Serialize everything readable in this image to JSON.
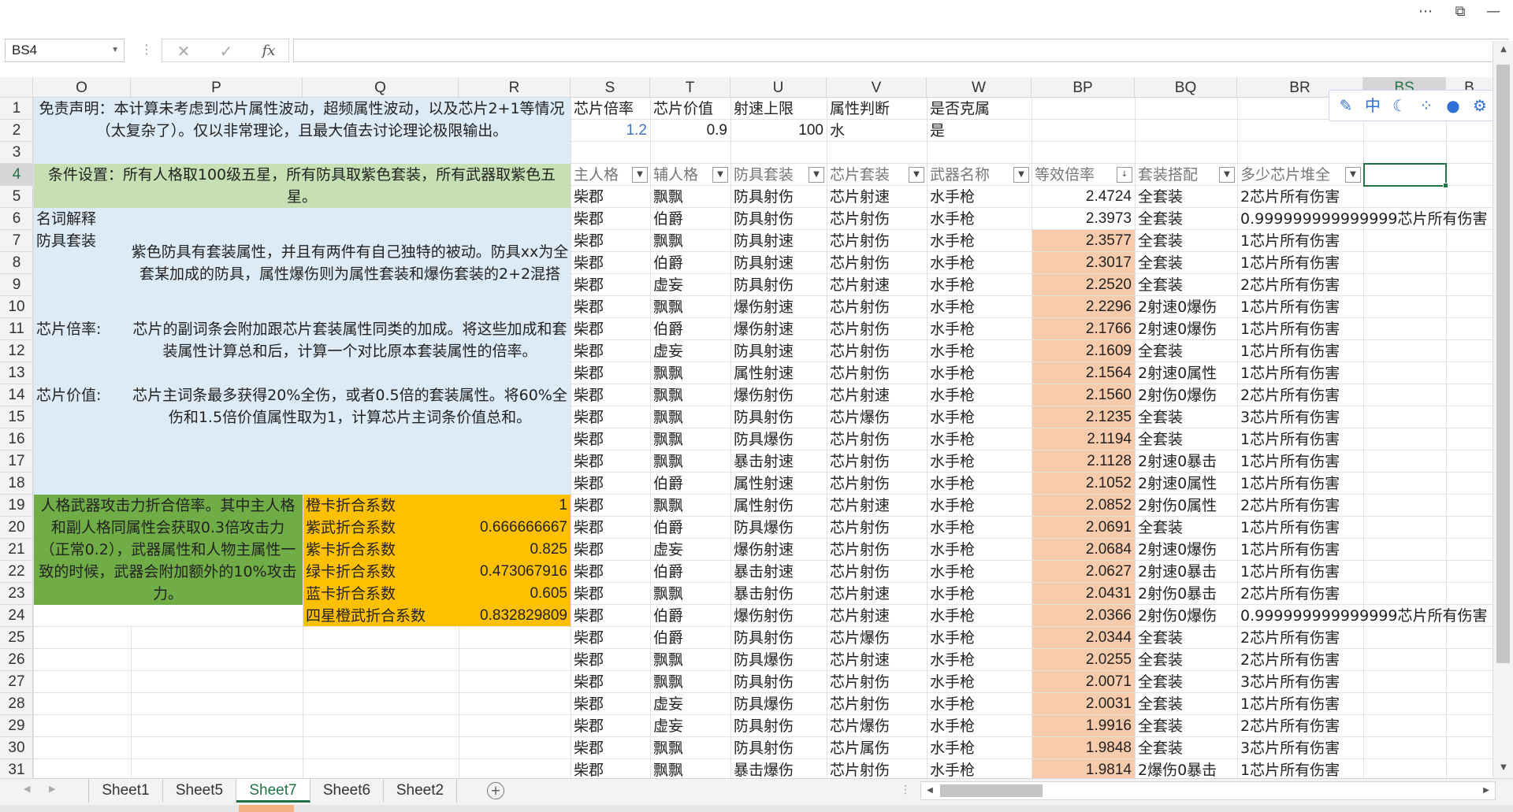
{
  "name_box": "BS4",
  "formula_icons": {
    "cancel": "✕",
    "enter": "✓",
    "fx": "fx"
  },
  "columns": [
    "O",
    "P",
    "Q",
    "R",
    "S",
    "T",
    "U",
    "V",
    "W",
    "BP",
    "BQ",
    "BR",
    "BS",
    "B"
  ],
  "rows": [
    "1",
    "2",
    "3",
    "4",
    "5",
    "6",
    "7",
    "8",
    "9",
    "10",
    "11",
    "12",
    "13",
    "14",
    "15",
    "16",
    "17",
    "18",
    "19",
    "20",
    "21",
    "22",
    "23",
    "24",
    "25",
    "26",
    "27",
    "28",
    "29",
    "30",
    "31"
  ],
  "notes": {
    "disclaimer": "免责声明：本计算未考虑到芯片属性波动，超频属性波动，以及芯片2+1等情况（太复杂了）。仅以非常理论，且最大值去讨论理论极限输出。",
    "conditions": "条件设置：所有人格取100级五星，所有防具取紫色套装，所有武器取紫色五星。",
    "glossary_title": "名词解释",
    "armor_set_label": "防具套装",
    "armor_set_text": "紫色防具有套装属性，并且有两件有自己独特的被动。防具xx为全套某加成的防具，属性爆伤则为属性套装和爆伤套装的2+2混搭",
    "chip_rate_label": "芯片倍率:",
    "chip_rate_text": "芯片的副词条会附加跟芯片套装属性同类的加成。将这些加成和套装属性计算总和后，计算一个对比原本套装属性的倍率。",
    "chip_value_label": "芯片价值:",
    "chip_value_text": "芯片主词条最多获得20%全伤，或者0.5倍的套装属性。将60%全伤和1.5倍价值属性取为1，计算芯片主词条价值总和。",
    "attack_text": "人格武器攻击力折合倍率。其中主人格和副人格同属性会获取0.3倍攻击力（正常0.2），武器属性和人物主属性一致的时候，武器会附加额外的10%攻击力。"
  },
  "coefficients": [
    {
      "label": "橙卡折合系数",
      "value": "1"
    },
    {
      "label": "紫武折合系数",
      "value": "0.666666667"
    },
    {
      "label": "紫卡折合系数",
      "value": "0.825"
    },
    {
      "label": "绿卡折合系数",
      "value": "0.473067916"
    },
    {
      "label": "蓝卡折合系数",
      "value": "0.605"
    },
    {
      "label": "四星橙武折合系数",
      "value": "0.832829809"
    }
  ],
  "params": {
    "headers": [
      "芯片倍率",
      "芯片价值",
      "射速上限",
      "属性判断",
      " 是否克属"
    ],
    "values": [
      "1.2",
      "0.9",
      "100",
      "水",
      "是"
    ]
  },
  "table": {
    "headers": [
      "主人格",
      "辅人格",
      "防具套装",
      "芯片套装",
      "武器名称",
      "等效倍率",
      "套装搭配",
      "多少芯片堆全"
    ],
    "sort_indicator": "↓",
    "rows": [
      [
        "柴郡",
        "飘飘",
        "防具射伤",
        "芯片射速",
        "水手枪",
        "2.4724",
        "全套装",
        "2芯片所有伤害"
      ],
      [
        "柴郡",
        "伯爵",
        "防具射伤",
        "芯片射伤",
        "水手枪",
        "2.3973",
        "全套装",
        "0.999999999999999芯片所有伤害"
      ],
      [
        "柴郡",
        "飘飘",
        "防具射速",
        "芯片射伤",
        "水手枪",
        "2.3577",
        "全套装",
        "1芯片所有伤害"
      ],
      [
        "柴郡",
        "伯爵",
        "防具射速",
        "芯片射伤",
        "水手枪",
        "2.3017",
        "全套装",
        "1芯片所有伤害"
      ],
      [
        "柴郡",
        "虚妄",
        "防具射伤",
        "芯片射速",
        "水手枪",
        "2.2520",
        "全套装",
        "2芯片所有伤害"
      ],
      [
        "柴郡",
        "飘飘",
        "爆伤射速",
        "芯片射伤",
        "水手枪",
        "2.2296",
        "2射速0爆伤",
        "1芯片所有伤害"
      ],
      [
        "柴郡",
        "伯爵",
        "爆伤射速",
        "芯片射伤",
        "水手枪",
        "2.1766",
        "2射速0爆伤",
        "1芯片所有伤害"
      ],
      [
        "柴郡",
        "虚妄",
        "防具射速",
        "芯片射伤",
        "水手枪",
        "2.1609",
        "全套装",
        "1芯片所有伤害"
      ],
      [
        "柴郡",
        "飘飘",
        "属性射速",
        "芯片射伤",
        "水手枪",
        "2.1564",
        "2射速0属性",
        "1芯片所有伤害"
      ],
      [
        "柴郡",
        "飘飘",
        "爆伤射伤",
        "芯片射速",
        "水手枪",
        "2.1560",
        "2射伤0爆伤",
        "2芯片所有伤害"
      ],
      [
        "柴郡",
        "飘飘",
        "防具射伤",
        "芯片爆伤",
        "水手枪",
        "2.1235",
        "全套装",
        "3芯片所有伤害"
      ],
      [
        "柴郡",
        "飘飘",
        "防具爆伤",
        "芯片射伤",
        "水手枪",
        "2.1194",
        "全套装",
        "1芯片所有伤害"
      ],
      [
        "柴郡",
        "飘飘",
        "暴击射速",
        "芯片射伤",
        "水手枪",
        "2.1128",
        "2射速0暴击",
        "1芯片所有伤害"
      ],
      [
        "柴郡",
        "伯爵",
        "属性射速",
        "芯片射伤",
        "水手枪",
        "2.1052",
        "2射速0属性",
        "1芯片所有伤害"
      ],
      [
        "柴郡",
        "飘飘",
        "属性射伤",
        "芯片射速",
        "水手枪",
        "2.0852",
        "2射伤0属性",
        "2芯片所有伤害"
      ],
      [
        "柴郡",
        "伯爵",
        "防具爆伤",
        "芯片射伤",
        "水手枪",
        "2.0691",
        "全套装",
        "1芯片所有伤害"
      ],
      [
        "柴郡",
        "虚妄",
        "爆伤射速",
        "芯片射伤",
        "水手枪",
        "2.0684",
        "2射速0爆伤",
        "1芯片所有伤害"
      ],
      [
        "柴郡",
        "伯爵",
        "暴击射速",
        "芯片射伤",
        "水手枪",
        "2.0627",
        "2射速0暴击",
        "1芯片所有伤害"
      ],
      [
        "柴郡",
        "飘飘",
        "暴击射伤",
        "芯片射速",
        "水手枪",
        "2.0431",
        "2射伤0暴击",
        "2芯片所有伤害"
      ],
      [
        "柴郡",
        "伯爵",
        "爆伤射伤",
        "芯片射速",
        "水手枪",
        "2.0366",
        "2射伤0爆伤",
        "0.999999999999999芯片所有伤害"
      ],
      [
        "柴郡",
        "伯爵",
        "防具射伤",
        "芯片爆伤",
        "水手枪",
        "2.0344",
        "全套装",
        "2芯片所有伤害"
      ],
      [
        "柴郡",
        "飘飘",
        "防具爆伤",
        "芯片射速",
        "水手枪",
        "2.0255",
        "全套装",
        "2芯片所有伤害"
      ],
      [
        "柴郡",
        "飘飘",
        "防具射伤",
        "芯片射伤",
        "水手枪",
        "2.0071",
        "全套装",
        "3芯片所有伤害"
      ],
      [
        "柴郡",
        "虚妄",
        "防具爆伤",
        "芯片射伤",
        "水手枪",
        "2.0031",
        "全套装",
        "1芯片所有伤害"
      ],
      [
        "柴郡",
        "虚妄",
        "防具射伤",
        "芯片爆伤",
        "水手枪",
        "1.9916",
        "全套装",
        "2芯片所有伤害"
      ],
      [
        "柴郡",
        "飘飘",
        "防具射伤",
        "芯片属伤",
        "水手枪",
        "1.9848",
        "全套装",
        "3芯片所有伤害"
      ],
      [
        "柴郡",
        "飘飘",
        "暴击爆伤",
        "芯片射伤",
        "水手枪",
        "1.9814",
        "2爆伤0暴击",
        "1芯片所有伤害"
      ]
    ]
  },
  "sheet_tabs": [
    "Sheet1",
    "Sheet5",
    "Sheet7",
    "Sheet6",
    "Sheet2"
  ],
  "active_tab": "Sheet7",
  "add_sheet": "+",
  "colors": {
    "selection": "#217346",
    "blue_note": "#ddebf7",
    "green_light": "#c6e0b4",
    "green_dark": "#70ad47",
    "orange": "#ffc000",
    "peach": "#f8cbad"
  },
  "toolbar_icons": [
    "edit-icon",
    "chinese-input-icon",
    "moon-icon",
    "dots-icon",
    "user-icon",
    "gear-icon"
  ]
}
